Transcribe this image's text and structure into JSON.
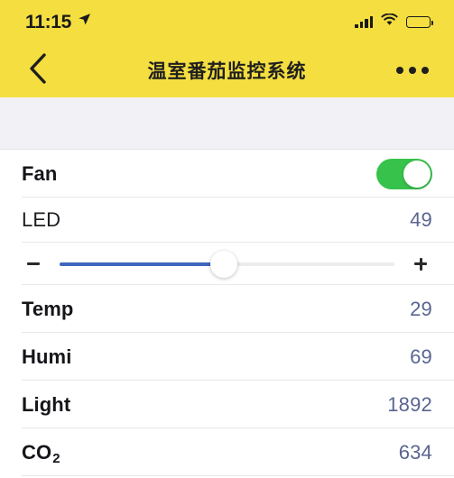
{
  "status_bar": {
    "time": "11:15",
    "location_icon": "location-arrow-icon",
    "signal_icon": "cellular-signal-icon",
    "wifi_icon": "wifi-icon",
    "battery_icon": "battery-full-icon"
  },
  "nav": {
    "back_icon": "chevron-left-icon",
    "title": "温室番茄监控系统",
    "more_icon": "more-horizontal-icon"
  },
  "colors": {
    "header_yellow": "#f4de40",
    "spacer_gray": "#f2f2f6",
    "toggle_green": "#36c24b",
    "slider_blue": "#3f66bd",
    "value_blue": "#5a6590",
    "divider": "#e9e9ec"
  },
  "list": {
    "fan": {
      "label": "Fan",
      "toggle_on": true,
      "toggle_state_text": "ON"
    },
    "led": {
      "label": "LED",
      "value": "49",
      "slider": {
        "min": 0,
        "max": 100,
        "value": 49,
        "percent": 49,
        "decrement_label": "-",
        "increment_label": "+",
        "decrement_icon": "minus-icon",
        "increment_icon": "plus-icon"
      }
    },
    "sensors": [
      {
        "label": "Temp",
        "value": "29",
        "sub": ""
      },
      {
        "label": "Humi",
        "value": "69",
        "sub": ""
      },
      {
        "label": "Light",
        "value": "1892",
        "sub": ""
      },
      {
        "label": "CO",
        "value": "634",
        "sub": "2"
      }
    ]
  }
}
